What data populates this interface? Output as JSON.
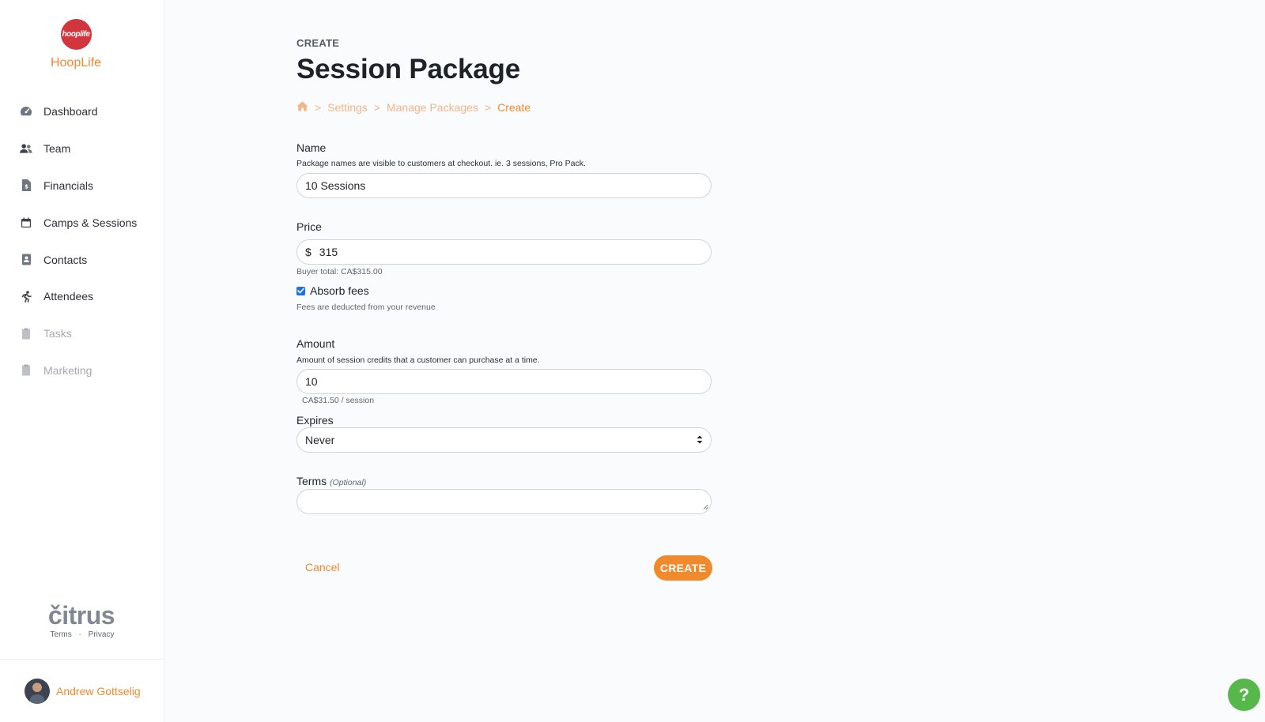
{
  "brand": {
    "logo_text": "hooplife",
    "name": "HoopLife"
  },
  "sidebar": {
    "items": [
      {
        "label": "Dashboard"
      },
      {
        "label": "Team"
      },
      {
        "label": "Financials"
      },
      {
        "label": "Camps & Sessions"
      },
      {
        "label": "Contacts"
      },
      {
        "label": "Attendees"
      },
      {
        "label": "Tasks"
      },
      {
        "label": "Marketing"
      }
    ],
    "footer_logo": "čitrus",
    "terms": "Terms",
    "divider": "·",
    "privacy": "Privacy",
    "user_name": "Andrew Gottselig"
  },
  "header": {
    "eyebrow": "CREATE",
    "title": "Session Package",
    "breadcrumb": {
      "sep": ">",
      "items": [
        "Settings",
        "Manage Packages",
        "Create"
      ]
    }
  },
  "form": {
    "name": {
      "label": "Name",
      "help": "Package names are visible to customers at checkout. ie. 3 sessions, Pro Pack.",
      "value": "10 Sessions"
    },
    "price": {
      "label": "Price",
      "prefix": "$",
      "value": "315",
      "buyer_total": "Buyer total: CA$315.00"
    },
    "absorb_fees": {
      "label": "Absorb fees",
      "checked": true,
      "help": "Fees are deducted from your revenue"
    },
    "amount": {
      "label": "Amount",
      "help": "Amount of session credits that a customer can purchase at a time.",
      "value": "10",
      "per_session": "CA$31.50 / session"
    },
    "expires": {
      "label": "Expires",
      "value": "Never"
    },
    "terms": {
      "label": "Terms",
      "optional": "(Optional)",
      "value": ""
    }
  },
  "actions": {
    "cancel": "Cancel",
    "create": "CREATE"
  },
  "help_button": "?",
  "colors": {
    "accent": "#f08a2c",
    "brand_red": "#d2353b",
    "help_green": "#56b84a",
    "checkbox_blue": "#1a73e8"
  }
}
